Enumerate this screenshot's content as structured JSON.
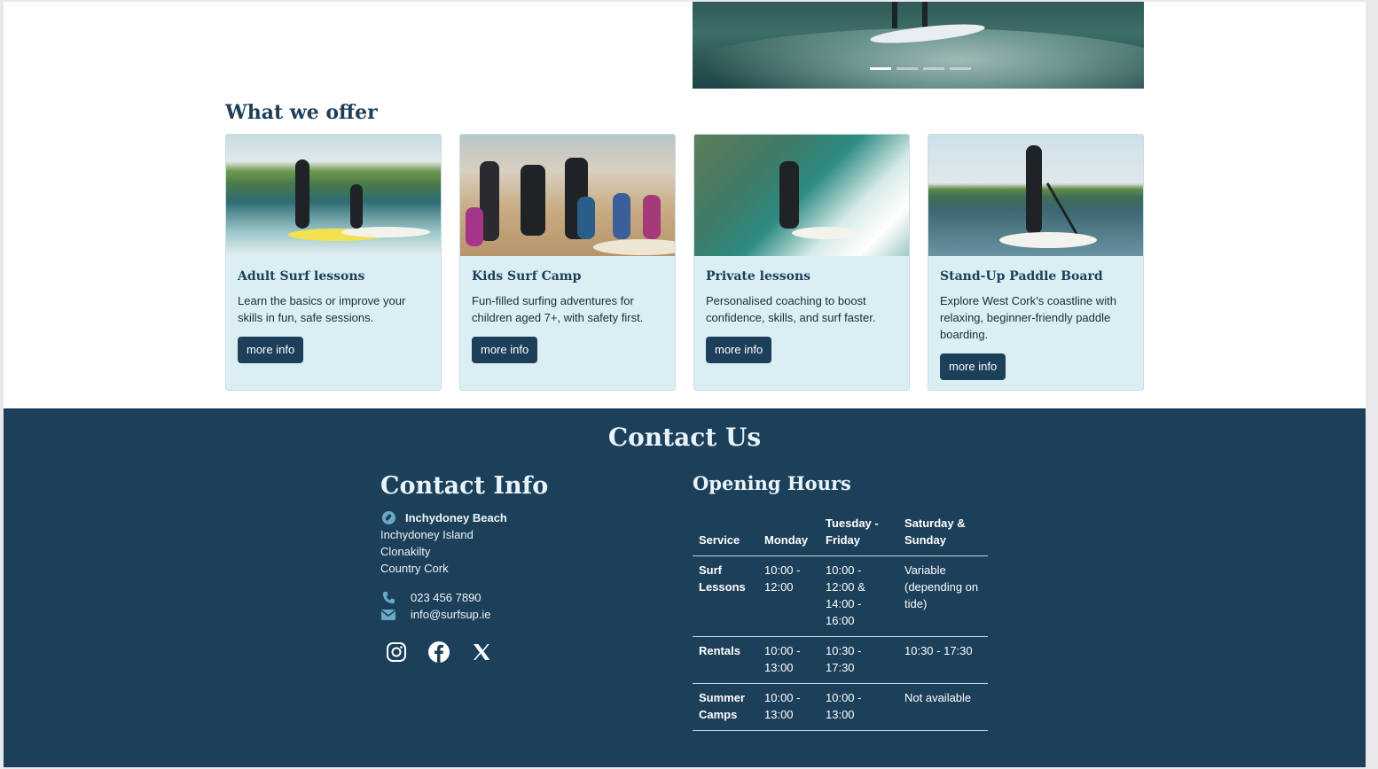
{
  "carousel": {
    "slide_count": 4,
    "active_index": 0
  },
  "offer": {
    "title": "What we offer",
    "cards": [
      {
        "title": "Adult Surf lessons",
        "text": "Learn the basics or improve your skills in fun, safe sessions.",
        "button": "more info"
      },
      {
        "title": "Kids Surf Camp",
        "text": "Fun-filled surfing adventures for children aged 7+, with safety first.",
        "button": "more info"
      },
      {
        "title": "Private lessons",
        "text": "Personalised coaching to boost confidence, skills, and surf faster.",
        "button": "more info"
      },
      {
        "title": "Stand-Up Paddle Board",
        "text": "Explore West Cork’s coastline with relaxing, beginner-friendly paddle boarding.",
        "button": "more info"
      }
    ]
  },
  "contact": {
    "heading": "Contact Us",
    "info_title": "Contact Info",
    "address": [
      "Inchydoney Beach",
      "Inchydoney Island",
      "Clonakilty",
      "Country Cork"
    ],
    "phone": "023 456 7890",
    "email": "info@surfsup.ie",
    "social": [
      "instagram-icon",
      "facebook-icon",
      "x-icon"
    ]
  },
  "hours": {
    "title": "Opening Hours",
    "headers": [
      "Service",
      "Monday",
      "Tuesday - Friday",
      "Saturday & Sunday"
    ],
    "rows": [
      [
        "Surf Lessons",
        "10:00 - 12:00",
        "10:00 - 12:00 & 14:00 - 16:00",
        "Variable (depending on tide)"
      ],
      [
        "Rentals",
        "10:00 - 13:00",
        "10:30 - 17:30",
        "10:30 - 17:30"
      ],
      [
        "Summer Camps",
        "10:00 - 13:00",
        "10:00 - 13:00",
        "Not available"
      ]
    ]
  },
  "colors": {
    "navy": "#1c3f5a",
    "card_bg": "#daeef3",
    "icon_blue": "#6aa8c7"
  }
}
